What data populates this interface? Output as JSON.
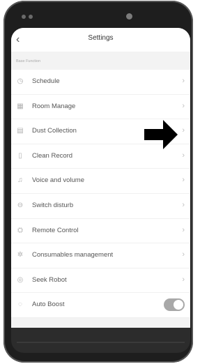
{
  "header": {
    "title": "Settings",
    "back_glyph": "‹"
  },
  "section": {
    "title": "Base Function"
  },
  "items": [
    {
      "label": "Schedule",
      "icon": "clock-icon",
      "glyph": "◷"
    },
    {
      "label": "Room Manage",
      "icon": "map-icon",
      "glyph": "▦"
    },
    {
      "label": "Dust Collection",
      "icon": "bin-icon",
      "glyph": "▤"
    },
    {
      "label": "Clean Record",
      "icon": "document-icon",
      "glyph": "▯"
    },
    {
      "label": "Voice and volume",
      "icon": "bell-icon",
      "glyph": "♫"
    },
    {
      "label": "Switch disturb",
      "icon": "moon-icon",
      "glyph": "⊖"
    },
    {
      "label": "Remote Control",
      "icon": "remote-icon",
      "glyph": "⛭"
    },
    {
      "label": "Consumables management",
      "icon": "box-icon",
      "glyph": "✲"
    },
    {
      "label": "Seek Robot",
      "icon": "location-icon",
      "glyph": "◎"
    }
  ],
  "auto_boost": {
    "label": "Auto Boost",
    "icon": "boost-icon",
    "glyph": "◌",
    "enabled": true
  },
  "chevron_glyph": "›",
  "colors": {
    "arrow": "#000000",
    "toggle_on": "#a8a8a8"
  }
}
